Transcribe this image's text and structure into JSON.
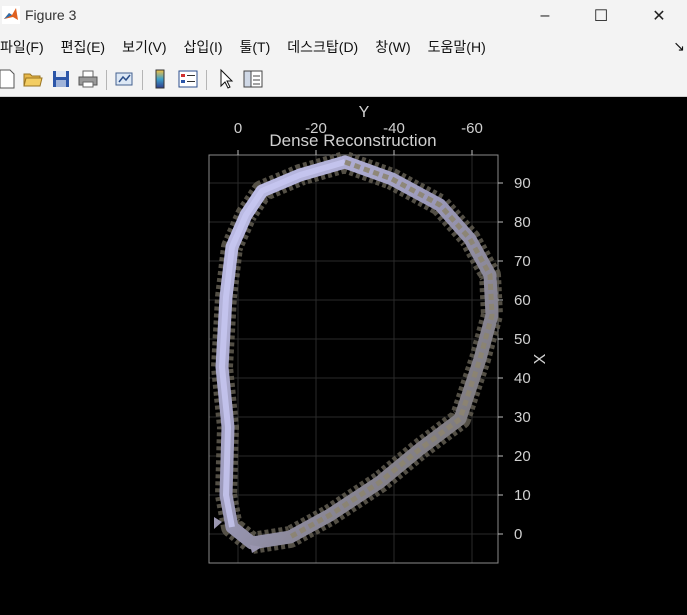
{
  "window": {
    "title": "Figure 3",
    "controls": {
      "minimize": "–",
      "maximize": "☐",
      "close": "✕"
    }
  },
  "menubar": {
    "items": [
      {
        "label": "파일(F)"
      },
      {
        "label": "편집(E)"
      },
      {
        "label": "보기(V)"
      },
      {
        "label": "삽입(I)"
      },
      {
        "label": "툴(T)"
      },
      {
        "label": "데스크탑(D)"
      },
      {
        "label": "창(W)"
      },
      {
        "label": "도움말(H)"
      }
    ],
    "overflow_glyph": "↘"
  },
  "toolbar": {
    "buttons": [
      {
        "name": "new-figure-icon"
      },
      {
        "name": "open-file-icon"
      },
      {
        "name": "save-icon"
      },
      {
        "name": "print-icon"
      },
      {
        "name": "link-plot-icon"
      },
      {
        "name": "colorbar-icon"
      },
      {
        "name": "legend-icon"
      },
      {
        "name": "edit-plot-pointer-icon"
      },
      {
        "name": "property-inspector-icon"
      }
    ]
  },
  "plot": {
    "title": "Dense Reconstruction",
    "y_axis_label": "Y",
    "x_axis_label": "X",
    "top_ticks": [
      "0",
      "-20",
      "-40",
      "-60"
    ],
    "right_ticks": [
      "90",
      "80",
      "70",
      "60",
      "50",
      "40",
      "30",
      "20",
      "10",
      "0"
    ],
    "colors": {
      "background": "#000000",
      "axis": "#bdbdbd",
      "grid": "#2a2a2a",
      "trajectory_light": "#b8b8e8",
      "trajectory_dark": "#6e6a5c",
      "trajectory_mid": "#8a8578"
    }
  }
}
